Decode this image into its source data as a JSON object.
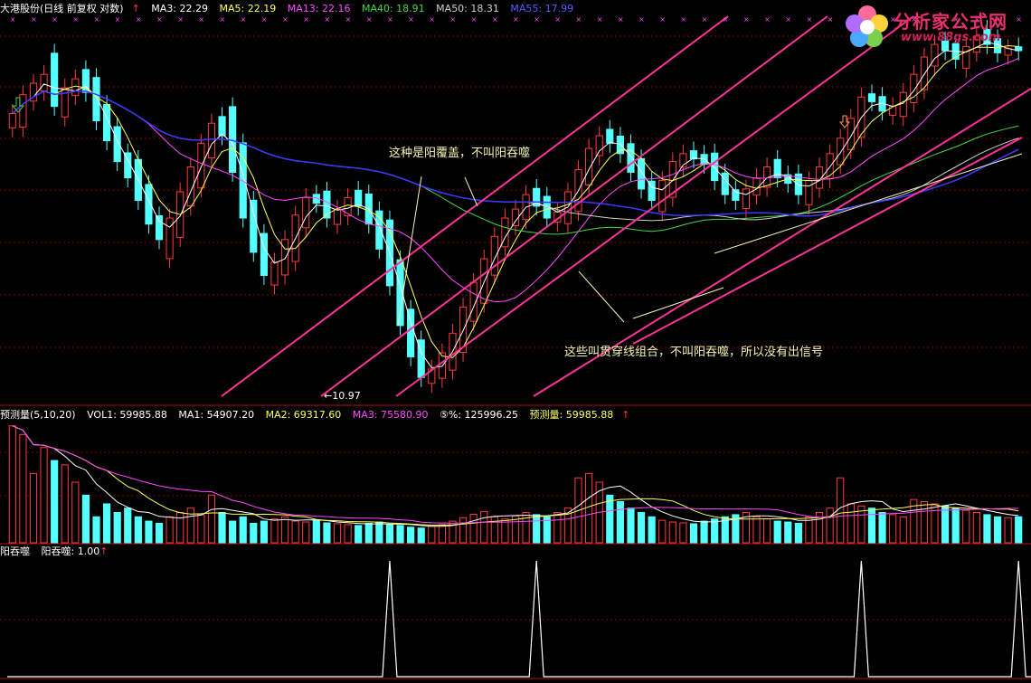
{
  "colors": {
    "up": "#ff3b3b",
    "down": "#54ffff",
    "ma3": "#ffffff",
    "ma5": "#ffff54",
    "ma13": "#ff48ff",
    "ma40": "#42d842",
    "ma50": "#d0d0d0",
    "ma55": "#3a3aff",
    "channel": "#ff3399",
    "note": "#f4f4b0",
    "grid": "#8b0000"
  },
  "main_header": {
    "title": "大港股份(日线 前复权 对数)",
    "ma3": "MA3: 22.29",
    "ma5": "MA5: 22.19",
    "ma13": "MA13: 22.16",
    "ma40": "MA40: 18.91",
    "ma50": "MA50: 18.31",
    "ma55": "MA55: 17.99",
    "arrow": "↑"
  },
  "vol_header": {
    "title": "预测量(5,10,20)",
    "vol1": "VOL1: 59985.88",
    "ma1": "MA1: 54907.20",
    "ma2": "MA2: 69317.60",
    "ma3": "MA3: 75580.90",
    "pct": "⑤%: 125996.25",
    "pred": "预测量: 59985.88",
    "arrow": "↑"
  },
  "sig_header": {
    "title": "阳吞噬",
    "value": "阳吞噬: 1.00",
    "arrow": "↑"
  },
  "annotations": {
    "cover": "这种是阳覆盖，不叫阳吞噬",
    "penetrate": "这些叫贯穿线组合，不叫阳吞噬，所以没有出信号",
    "low_price": "10.97"
  },
  "watermark": {
    "title": "分析家公式网",
    "url": "www.88gs.com"
  },
  "chart_data": [
    {
      "type": "candlestick",
      "title": "大港股份(日线 前复权 对数)",
      "scale": "log",
      "ylim": [
        10.5,
        24
      ],
      "low_label": 10.97,
      "moving_averages": [
        {
          "name": "MA3",
          "last": 22.29
        },
        {
          "name": "MA5",
          "last": 22.19
        },
        {
          "name": "MA13",
          "last": 22.16
        },
        {
          "name": "MA40",
          "last": 18.91
        },
        {
          "name": "MA50",
          "last": 18.31
        },
        {
          "name": "MA55",
          "last": 17.99
        }
      ],
      "close": [
        19.5,
        20.3,
        20.8,
        21.2,
        19.8,
        20.6,
        21.0,
        20.4,
        19.2,
        18.4,
        17.6,
        17.0,
        16.2,
        15.4,
        14.9,
        15.6,
        16.5,
        17.4,
        18.3,
        19.1,
        18.6,
        17.2,
        15.6,
        14.5,
        13.8,
        14.2,
        14.9,
        15.7,
        16.3,
        16.1,
        15.6,
        15.9,
        16.3,
        16.0,
        15.4,
        14.6,
        13.5,
        12.4,
        11.6,
        11.1,
        11.3,
        11.7,
        12.2,
        12.9,
        13.6,
        14.3,
        15.0,
        15.6,
        15.9,
        16.4,
        16.0,
        15.6,
        15.8,
        16.5,
        17.3,
        18.1,
        18.6,
        18.3,
        17.9,
        17.2,
        16.6,
        16.2,
        16.9,
        17.6,
        17.9,
        17.7,
        17.5,
        16.9,
        16.4,
        16.2,
        16.6,
        17.0,
        17.4,
        17.0,
        16.8,
        16.4,
        16.9,
        17.4,
        17.9,
        18.5,
        19.3,
        20.2,
        20.0,
        19.6,
        19.8,
        20.4,
        21.2,
        22.0,
        22.6,
        22.3,
        21.9,
        22.5,
        23.0,
        22.6,
        22.2,
        22.4,
        22.3
      ]
    },
    {
      "type": "bar",
      "title": "预测量(5,10,20)",
      "series": [
        {
          "name": "VOL1",
          "last": 59985.88
        },
        {
          "name": "MA1",
          "last": 54907.2
        },
        {
          "name": "MA2",
          "last": 69317.6
        },
        {
          "name": "MA3",
          "last": 75580.9
        }
      ],
      "values": [
        270000,
        250000,
        160000,
        220000,
        190000,
        180000,
        140000,
        110000,
        60000,
        90000,
        70000,
        80000,
        60000,
        50000,
        45000,
        60000,
        70000,
        80000,
        65000,
        110000,
        70000,
        50000,
        60000,
        45000,
        50000,
        55000,
        60000,
        50000,
        48000,
        52000,
        46000,
        44000,
        42000,
        40000,
        45000,
        48000,
        42000,
        40000,
        36000,
        34000,
        38000,
        42000,
        50000,
        58000,
        66000,
        72000,
        60000,
        55000,
        62000,
        70000,
        65000,
        60000,
        70000,
        80000,
        150000,
        160000,
        140000,
        110000,
        95000,
        80000,
        70000,
        60000,
        52000,
        48000,
        46000,
        44000,
        50000,
        55000,
        60000,
        65000,
        70000,
        60000,
        55000,
        50000,
        48000,
        45000,
        60000,
        70000,
        80000,
        150000,
        90000,
        85000,
        80000,
        70000,
        65000,
        60000,
        100000,
        95000,
        90000,
        85000,
        80000,
        75000,
        70000,
        65000,
        60000,
        58000,
        60000
      ]
    },
    {
      "type": "line",
      "title": "阳吞噬",
      "series": [
        {
          "name": "阳吞噬",
          "last": 1.0
        }
      ],
      "signal_bars": [
        36,
        50,
        81,
        96
      ]
    }
  ]
}
